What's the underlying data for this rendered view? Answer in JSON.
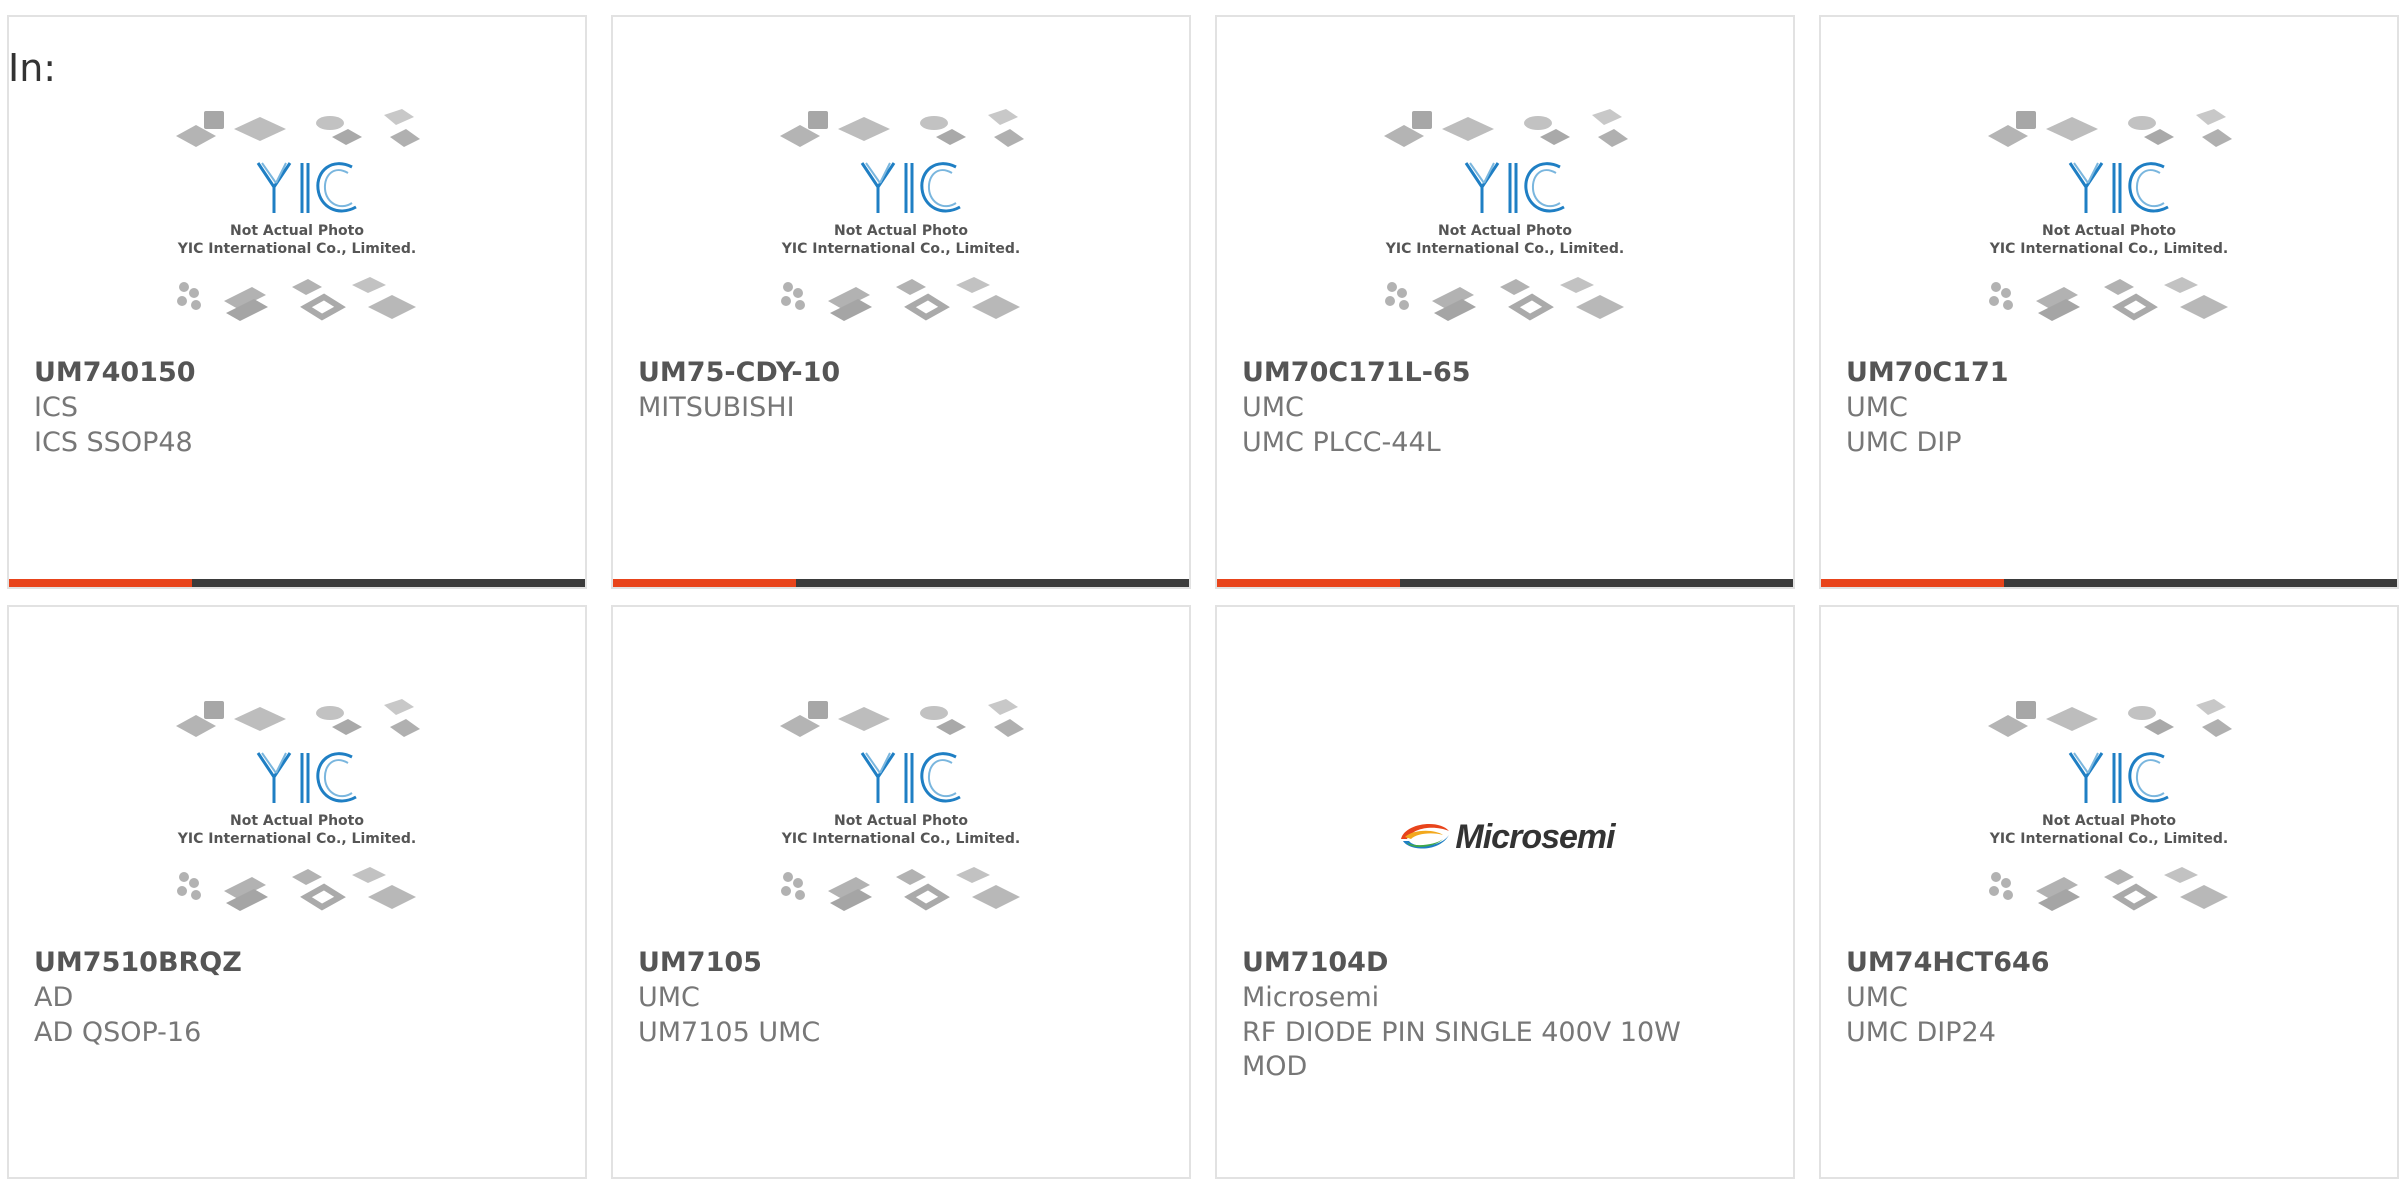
{
  "page": {
    "in_label": "In:"
  },
  "placeholder": {
    "line1": "Not Actual Photo",
    "line2": "YIC International Co., Limited."
  },
  "colors": {
    "accent": "#e8441b",
    "bar": "#3b3b3b",
    "yic_blue": "#1f7fc4"
  },
  "products": [
    {
      "part": "UM740150",
      "mfr": "ICS",
      "desc": "ICS SSOP48",
      "image": "yic-placeholder",
      "bar": true
    },
    {
      "part": "UM75-CDY-10",
      "mfr": "MITSUBISHI",
      "desc": "",
      "image": "yic-placeholder",
      "bar": true
    },
    {
      "part": "UM70C171L-65",
      "mfr": "UMC",
      "desc": "UMC PLCC-44L",
      "image": "yic-placeholder",
      "bar": true
    },
    {
      "part": "UM70C171",
      "mfr": "UMC",
      "desc": "UMC DIP",
      "image": "yic-placeholder",
      "bar": true
    },
    {
      "part": "UM7510BRQZ",
      "mfr": "AD",
      "desc": "AD QSOP-16",
      "image": "yic-placeholder",
      "bar": false
    },
    {
      "part": "UM7105",
      "mfr": "UMC",
      "desc": "UM7105 UMC",
      "image": "yic-placeholder",
      "bar": false
    },
    {
      "part": "UM7104D",
      "mfr": "Microsemi",
      "desc": "RF DIODE PIN SINGLE 400V 10W MOD",
      "image": "microsemi-logo",
      "logo_text": "Microsemi",
      "bar": false
    },
    {
      "part": "UM74HCT646",
      "mfr": "UMC",
      "desc": "UMC DIP24",
      "image": "yic-placeholder",
      "bar": false
    }
  ]
}
